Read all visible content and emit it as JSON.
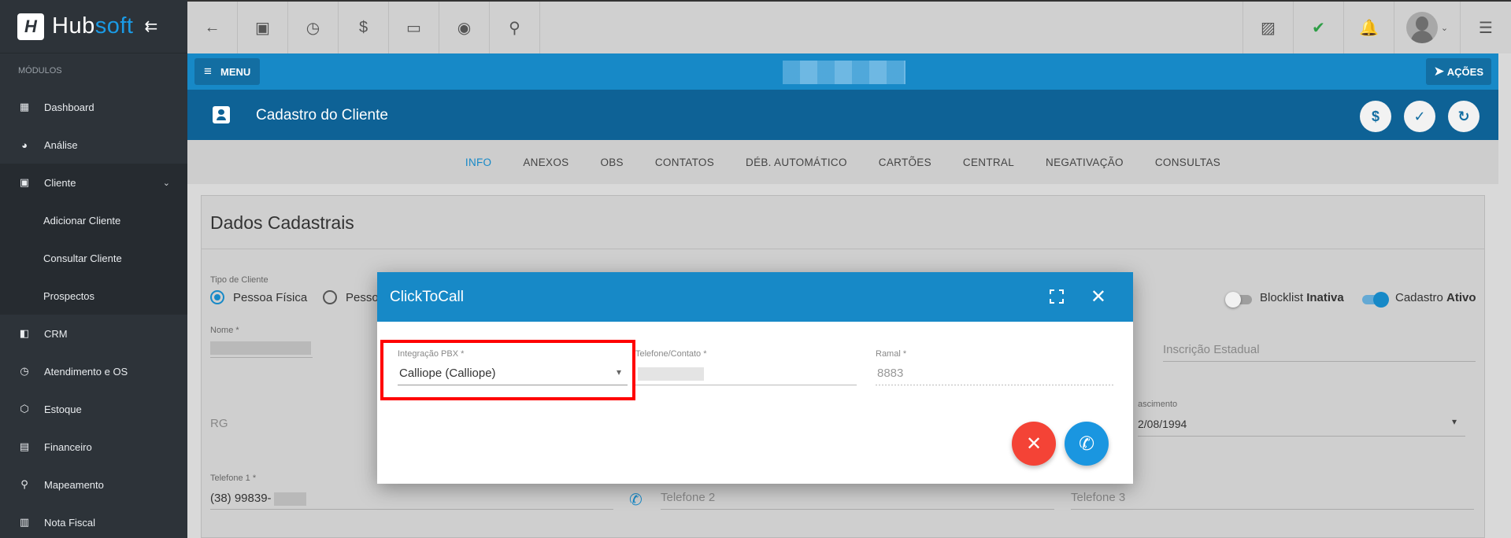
{
  "brand": {
    "name_a": "Hub",
    "name_b": "soft",
    "logo_letter": "H",
    "collapse_glyph": "⇇"
  },
  "sidebar": {
    "section_label": "MÓDULOS",
    "items": [
      {
        "label": "Dashboard",
        "icon": "grid-icon",
        "glyph": "▦"
      },
      {
        "label": "Análise",
        "icon": "pie-chart-icon",
        "glyph": "◕"
      },
      {
        "label": "Cliente",
        "icon": "contact-card-icon",
        "glyph": "▣",
        "chevron": "⌄"
      },
      {
        "label": "Adicionar Cliente"
      },
      {
        "label": "Consultar Cliente"
      },
      {
        "label": "Prospectos"
      },
      {
        "label": "CRM",
        "icon": "kanban-icon",
        "glyph": "◧"
      },
      {
        "label": "Atendimento e OS",
        "icon": "calendar-clock-icon",
        "glyph": "◷"
      },
      {
        "label": "Estoque",
        "icon": "package-icon",
        "glyph": "⬡"
      },
      {
        "label": "Financeiro",
        "icon": "money-icon",
        "glyph": "▤"
      },
      {
        "label": "Mapeamento",
        "icon": "map-pin-icon",
        "glyph": "⚲"
      },
      {
        "label": "Nota Fiscal",
        "icon": "receipt-icon",
        "glyph": "▥"
      }
    ]
  },
  "topbar": {
    "left_icons": [
      {
        "name": "back-arrow-icon",
        "glyph": "←"
      },
      {
        "name": "contact-card-icon",
        "glyph": "▣"
      },
      {
        "name": "calendar-clock-icon",
        "glyph": "◷"
      },
      {
        "name": "dollar-icon",
        "glyph": "$"
      },
      {
        "name": "terminal-icon",
        "glyph": "▭"
      },
      {
        "name": "eye-icon",
        "glyph": "◉"
      },
      {
        "name": "search-icon",
        "glyph": "⚲"
      }
    ],
    "right_icons": [
      {
        "name": "pdf-icon",
        "glyph": "▨",
        "color": "#555555"
      },
      {
        "name": "chat-check-icon",
        "glyph": "✔",
        "color": "#2e9e46"
      },
      {
        "name": "alarm-bell-icon",
        "glyph": "🔔",
        "color": "#e03a3a"
      }
    ],
    "avatar_chevron": "⌄",
    "list_icon_glyph": "☰"
  },
  "header": {
    "menu_label": "MENU",
    "menu_glyph": "≡",
    "actions_label": "AÇÕES",
    "actions_glyph": "➤",
    "page_title": "Cadastro do Cliente",
    "round_buttons": [
      {
        "name": "dollar-button",
        "glyph": "$"
      },
      {
        "name": "check-button",
        "glyph": "✓"
      },
      {
        "name": "refresh-button",
        "glyph": "↻"
      }
    ]
  },
  "tabs": [
    "INFO",
    "ANEXOS",
    "OBS",
    "CONTATOS",
    "DÉB. AUTOMÁTICO",
    "CARTÕES",
    "CENTRAL",
    "NEGATIVAÇÃO",
    "CONSULTAS"
  ],
  "form": {
    "section_title": "Dados Cadastrais",
    "client_type_label": "Tipo de Cliente",
    "client_type_options": [
      "Pessoa Física",
      "Pesso"
    ],
    "blocklist_label": "Blocklist",
    "blocklist_state": "Inativa",
    "cadastro_label": "Cadastro",
    "cadastro_state": "Ativo",
    "nome_label": "Nome *",
    "inscricao_placeholder": "Inscrição Estadual",
    "rg_placeholder": "RG",
    "nascimento_label": "ascimento",
    "nascimento_value": "2/08/1994",
    "telefone1_label": "Telefone 1 *",
    "telefone1_value": "(38) 99839-",
    "telefone2_placeholder": "Telefone 2",
    "telefone3_placeholder": "Telefone 3",
    "phone_icon_glyph": "✆"
  },
  "modal": {
    "title": "ClickToCall",
    "expand_icon": "fullscreen-icon",
    "close_glyph": "✕",
    "pbx_label": "Integração PBX *",
    "pbx_value": "Calliope (Calliope)",
    "pbx_caret": "▾",
    "telefone_label": "Telefone/Contato *",
    "ramal_label": "Ramal *",
    "ramal_value": "8883",
    "cancel_glyph": "✕",
    "call_glyph": "✆",
    "cancel_color": "#f44336",
    "call_color": "#1a96e0"
  }
}
